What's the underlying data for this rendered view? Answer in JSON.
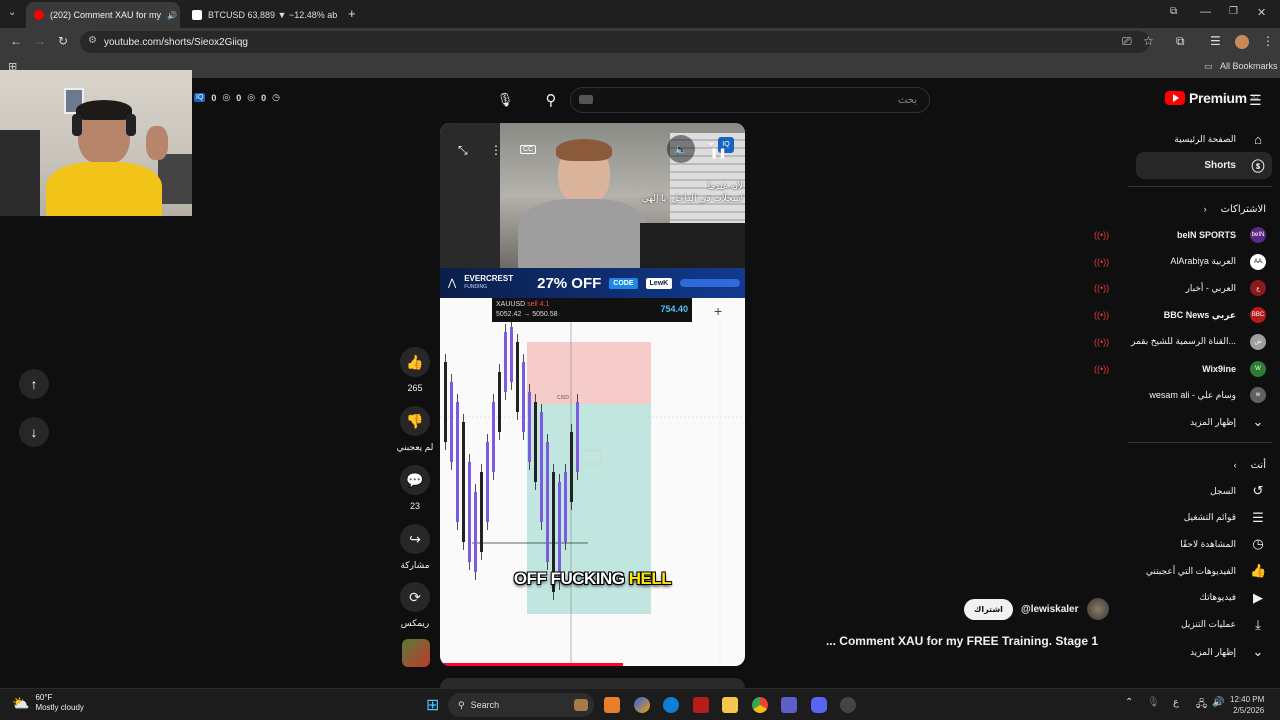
{
  "browser": {
    "tabs": [
      {
        "title": "(202) Comment XAU for my",
        "active": true
      },
      {
        "title": "BTCUSD 63,889 ▼ −12.48% ab",
        "active": false
      }
    ],
    "new_tab": "+",
    "url": "youtube.com/shorts/Sieox2Giiqg",
    "bookmarks_label": "All Bookmarks"
  },
  "stream_overlay": {
    "stats": [
      "0",
      "0",
      "0"
    ]
  },
  "youtube": {
    "search_placeholder": "بحث",
    "logo_text": "Premium",
    "logo_sup": "JO",
    "sidebar": {
      "home": "الصفحة الرئيسية",
      "shorts": "Shorts",
      "subscriptions_header": "الاشتراكات",
      "channels": [
        {
          "name": "beIN SPORTS",
          "color": "#5b2a86",
          "avatar": "beIN"
        },
        {
          "name": "AlArabiya العربية",
          "color": "#ffffff",
          "avatar": "AA"
        },
        {
          "name": "العربي - أخبار",
          "color": "#8b1a1a",
          "avatar": "ع"
        },
        {
          "name": "BBC News عربي",
          "color": "#b71c1c",
          "avatar": "BBC"
        },
        {
          "name": "القناة الرسمية للشيخ بقمر...",
          "color": "#9e9e9e",
          "avatar": "ش"
        },
        {
          "name": "Wix9ine",
          "color": "#2e7d32",
          "avatar": "W"
        },
        {
          "name": "wesam ali - وسام علي",
          "color": "#616161",
          "avatar": "w"
        }
      ],
      "show_more_1": "إظهار المزيد",
      "you_header": "أنت",
      "you_items": [
        {
          "label": "السجل",
          "icon": "history-icon"
        },
        {
          "label": "قوائم التشغيل",
          "icon": "playlists-icon"
        },
        {
          "label": "المشاهدة لاحقًا",
          "icon": "watch-later-icon"
        },
        {
          "label": "الفيديوهات التي أعجبتني",
          "icon": "liked-videos-icon"
        },
        {
          "label": "فيديوهاتك",
          "icon": "your-videos-icon"
        },
        {
          "label": "عمليات التنزيل",
          "icon": "downloads-icon"
        }
      ],
      "show_more_2": "إظهار المزيد"
    },
    "short": {
      "caption_line1": "لأنه عندما",
      "caption_line2": "سجلات في الداخل، يا إلهي!",
      "cc_label": "CC",
      "ad_brand": "EVERCREST",
      "ad_brand_sub": "FUNDING",
      "ad_offer": "27% OFF",
      "ad_code_label": "CODE",
      "ad_code": "LewK",
      "trade_symbol": "XAUUSD",
      "trade_side": "sell 4.1",
      "trade_prices": "5052.42 → 5050.58",
      "trade_pnl": "754.40",
      "chart_label": "CISD",
      "subtitle_a": "OFF FUCKING ",
      "subtitle_b": "HELL",
      "progress": 0.6
    },
    "actions": {
      "likes": "265",
      "dislike_label": "لم يعجبني",
      "comments": "23",
      "share_label": "مشاركة",
      "remix_label": "ريمكس"
    },
    "channel": {
      "handle": "@lewiskaler",
      "subscribe_label": "اشتراك",
      "title": "... Comment XAU for my FREE Training. Stage 1"
    }
  },
  "taskbar": {
    "weather_temp": "60°F",
    "weather_desc": "Mostly cloudy",
    "search_label": "Search",
    "lang": "ع",
    "time": "12:40 PM",
    "date": "2/5/2026"
  }
}
